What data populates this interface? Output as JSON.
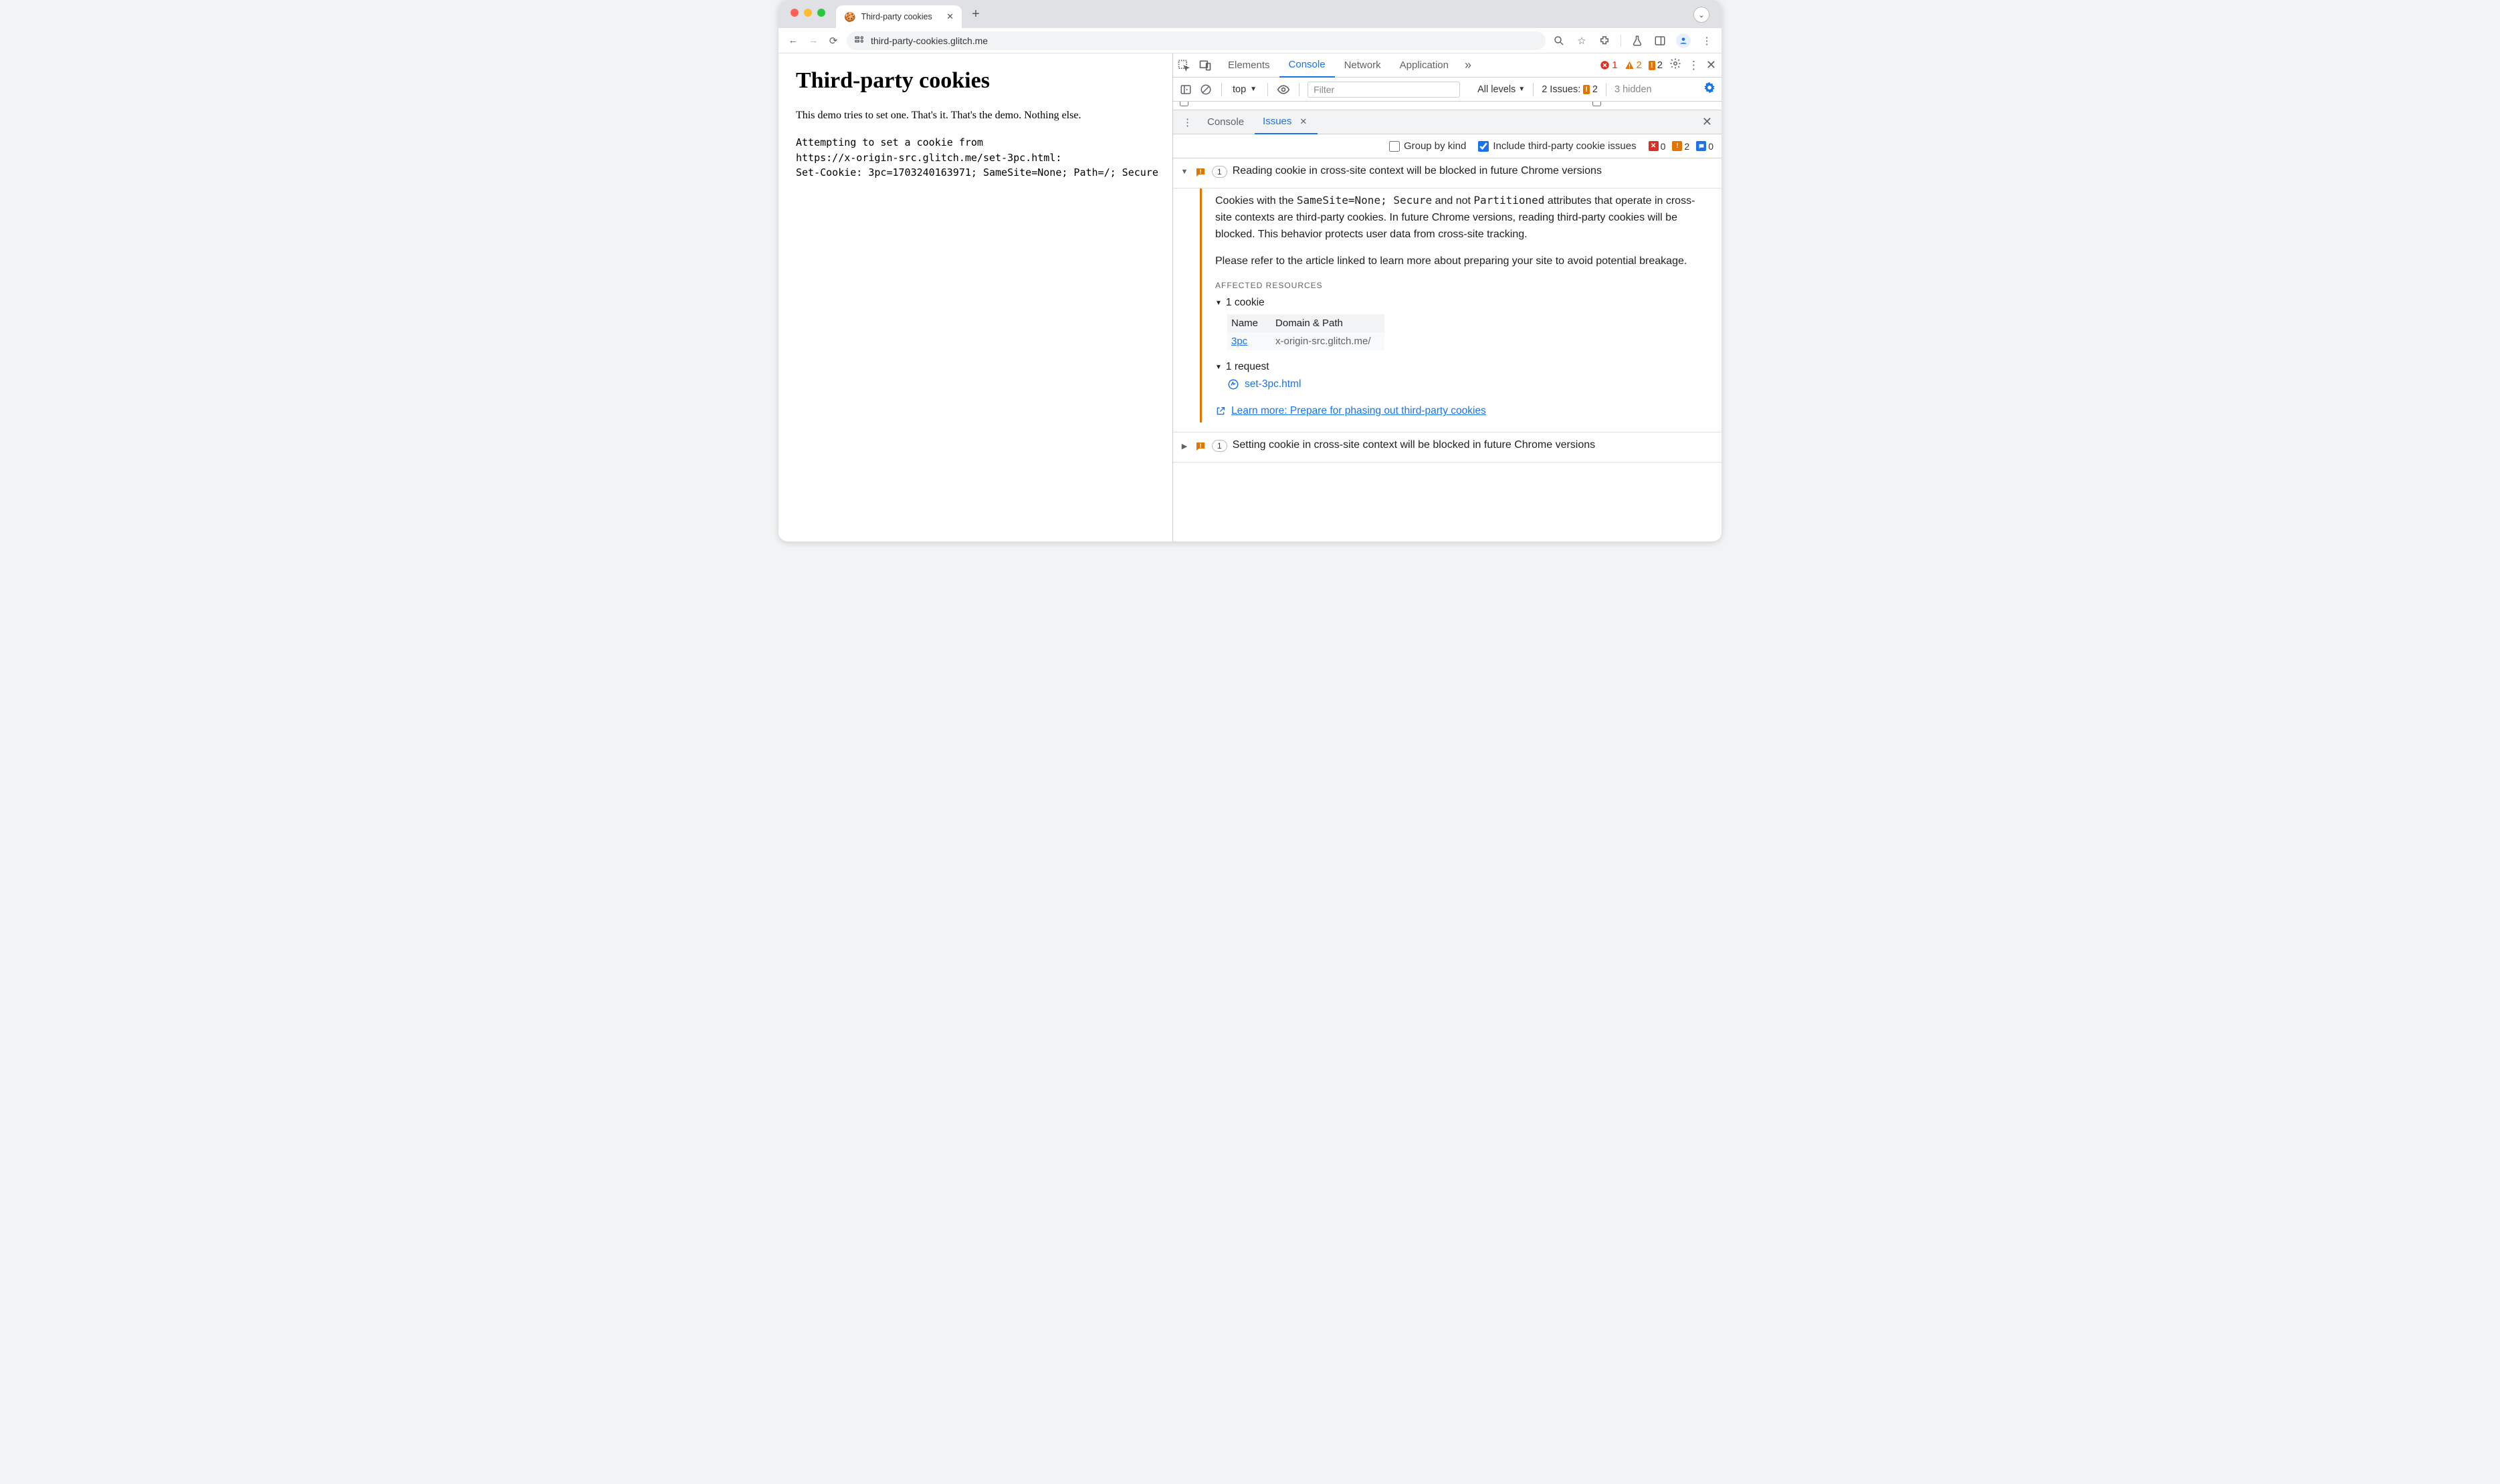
{
  "browser": {
    "tab_title": "Third-party cookies",
    "url": "third-party-cookies.glitch.me"
  },
  "page": {
    "heading": "Third-party cookies",
    "intro": "This demo tries to set one. That's it. That's the demo. Nothing else.",
    "log_line1": "Attempting to set a cookie from",
    "log_line2": "https://x-origin-src.glitch.me/set-3pc.html:",
    "log_line3": "Set-Cookie: 3pc=1703240163971; SameSite=None; Path=/; Secure"
  },
  "devtools": {
    "tabs": {
      "elements": "Elements",
      "console": "Console",
      "network": "Network",
      "application": "Application"
    },
    "status": {
      "errors": "1",
      "warnings": "2",
      "issues": "2"
    },
    "console_toolbar": {
      "context": "top",
      "filter_placeholder": "Filter",
      "levels": "All levels",
      "issues_label": "2 Issues:",
      "issues_count": "2",
      "hidden": "3 hidden"
    },
    "drawer": {
      "console_tab": "Console",
      "issues_tab": "Issues"
    },
    "issues_filter": {
      "group_by_kind": "Group by kind",
      "include_3p": "Include third-party cookie issues",
      "counts": {
        "red": "0",
        "orange": "2",
        "blue": "0"
      }
    },
    "issue1": {
      "count": "1",
      "title": "Reading cookie in cross-site context will be blocked in future Chrome versions",
      "para1a": "Cookies with the ",
      "para1_code1": "SameSite=None; Secure",
      "para1b": " and not ",
      "para1_code2": "Partitioned",
      "para1c": " attributes that operate in cross-site contexts are third-party cookies. In future Chrome versions, reading third-party cookies will be blocked. This behavior protects user data from cross-site tracking.",
      "para2": "Please refer to the article linked to learn more about preparing your site to avoid potential breakage.",
      "affected_heading": "AFFECTED RESOURCES",
      "cookie_section": "1 cookie",
      "table": {
        "col_name": "Name",
        "col_domain": "Domain & Path",
        "row_name": "3pc",
        "row_domain": "x-origin-src.glitch.me/"
      },
      "request_section": "1 request",
      "request_link": "set-3pc.html",
      "learn_more": "Learn more: Prepare for phasing out third-party cookies"
    },
    "issue2": {
      "count": "1",
      "title": "Setting cookie in cross-site context will be blocked in future Chrome versions"
    }
  }
}
